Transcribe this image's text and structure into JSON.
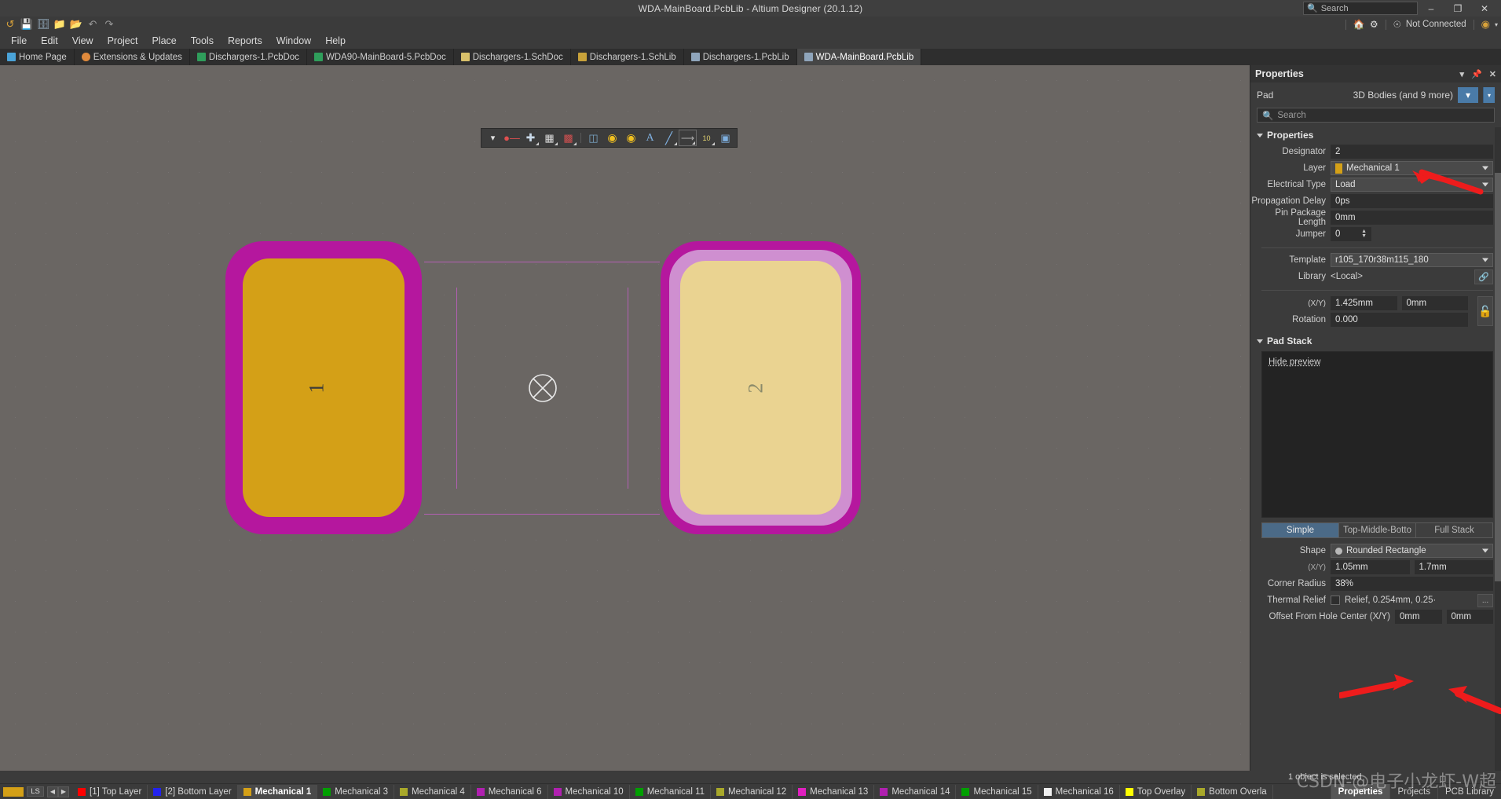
{
  "titlebar": {
    "title": "WDA-MainBoard.PcbLib - Altium Designer (20.1.12)",
    "search_placeholder": "Search",
    "minimize": "–",
    "maximize": "❐",
    "close": "✕"
  },
  "quickbar": {
    "icons": [
      "history-icon",
      "save-icon",
      "save-all-icon",
      "open-icon",
      "open-project-icon",
      "undo-icon",
      "redo-icon"
    ],
    "right": {
      "home_label": "home-icon",
      "settings_label": "gear-icon",
      "connection_status": "Not Connected",
      "account_icon": "account-icon",
      "chevron": "▾"
    }
  },
  "menu": {
    "items": [
      {
        "label": "File",
        "accel": "F"
      },
      {
        "label": "Edit",
        "accel": "E"
      },
      {
        "label": "View",
        "accel": "V"
      },
      {
        "label": "Project",
        "accel": "c"
      },
      {
        "label": "Place",
        "accel": "P"
      },
      {
        "label": "Tools",
        "accel": "T"
      },
      {
        "label": "Reports",
        "accel": "R"
      },
      {
        "label": "Window",
        "accel": "W"
      },
      {
        "label": "Help",
        "accel": "H"
      }
    ]
  },
  "doctabs": [
    {
      "label": "Home Page",
      "icon": "home-icon",
      "color": "#4aa3d8",
      "active": false
    },
    {
      "label": "Extensions & Updates",
      "icon": "extensions-icon",
      "color": "#e08a3c",
      "active": false
    },
    {
      "label": "Dischargers-1.PcbDoc",
      "icon": "pcbdoc-icon",
      "color": "#2f9e5b",
      "active": false
    },
    {
      "label": "WDA90-MainBoard-5.PcbDoc",
      "icon": "pcbdoc-icon",
      "color": "#2f9e5b",
      "active": false
    },
    {
      "label": "Dischargers-1.SchDoc",
      "icon": "schdoc-icon",
      "color": "#d8c06a",
      "active": false
    },
    {
      "label": "Dischargers-1.SchLib",
      "icon": "schlib-icon",
      "color": "#c8a23a",
      "active": false
    },
    {
      "label": "Dischargers-1.PcbLib",
      "icon": "pcblib-icon",
      "color": "#8fa5bb",
      "active": false
    },
    {
      "label": "WDA-MainBoard.PcbLib",
      "icon": "pcblib-icon",
      "color": "#8fa5bb",
      "active": true
    }
  ],
  "canvas_toolbar": {
    "buttons": [
      {
        "name": "filter-icon",
        "glyph": "▼",
        "color": "#dcdcdc"
      },
      {
        "name": "magnet-snap-icon",
        "glyph": "U",
        "color": "#e05050"
      },
      {
        "name": "crosshair-place-icon",
        "glyph": "✚",
        "color": "#b8c8d8"
      },
      {
        "name": "select-region-icon",
        "glyph": "⬚",
        "color": "#cfcfcf"
      },
      {
        "name": "align-icon",
        "glyph": "█",
        "color": "#d05050"
      },
      {
        "name": "layers-icon",
        "glyph": "▰",
        "color": "#7aa7c7"
      },
      {
        "name": "via-icon",
        "glyph": "◉",
        "color": "#f0c020"
      },
      {
        "name": "pad-icon",
        "glyph": "◉",
        "color": "#f0c020"
      },
      {
        "name": "text-icon",
        "glyph": "A",
        "color": "#7fb0e0"
      },
      {
        "name": "line-icon",
        "glyph": "╱",
        "color": "#7fb0e0"
      },
      {
        "name": "dimension-icon",
        "glyph": "↗",
        "color": "#b8b8b8"
      },
      {
        "name": "coordinate-icon",
        "glyph": "10",
        "color": "#e0d070"
      },
      {
        "name": "polygon-icon",
        "glyph": "▣",
        "color": "#7fb0e0"
      }
    ]
  },
  "canvas": {
    "pad1_designator": "1",
    "pad2_designator": "2",
    "origin_marker": "origin-crosshair",
    "pad_outer_color": "#b5179e",
    "pad1_fill": "#d4a017",
    "pad2_fill": "#ead391",
    "pad2_ring": "#cf8fd0",
    "courtyard_color": "#b35fb3",
    "background": "#6a6663"
  },
  "properties": {
    "panel_title": "Properties",
    "object_type": "Pad",
    "object_scope": "3D Bodies (and 9 more)",
    "search_placeholder": "Search",
    "sections": {
      "properties_label": "Properties",
      "pad_stack_label": "Pad Stack"
    },
    "fields": [
      {
        "label": "Designator",
        "value": "2",
        "type": "text"
      },
      {
        "label": "Layer",
        "value": "Mechanical 1",
        "type": "combo",
        "swatch": "#d4a017"
      },
      {
        "label": "Electrical Type",
        "value": "Load",
        "type": "combo"
      },
      {
        "label": "Propagation Delay",
        "value": "0ps",
        "type": "text"
      },
      {
        "label": "Pin Package Length",
        "value": "0mm",
        "type": "text"
      },
      {
        "label": "Jumper",
        "value": "0",
        "type": "spin"
      }
    ],
    "template": {
      "label": "Template",
      "value": "r105_170r38m115_180"
    },
    "library": {
      "label": "Library",
      "value": "<Local>",
      "link_icon": "link-icon"
    },
    "position": {
      "label": "(X/Y)",
      "x": "1.425mm",
      "y": "0mm"
    },
    "rotation": {
      "label": "Rotation",
      "value": "0.000"
    },
    "lock_icon": "unlock-icon",
    "hide_preview": "Hide preview",
    "stack_tabs": [
      {
        "label": "Simple",
        "active": true
      },
      {
        "label": "Top-Middle-Botto",
        "active": false
      },
      {
        "label": "Full Stack",
        "active": false
      }
    ],
    "shape": {
      "label": "Shape",
      "value": "Rounded Rectangle"
    },
    "size": {
      "label": "(X/Y)",
      "x": "1.05mm",
      "y": "1.7mm"
    },
    "corner_radius": {
      "label": "Corner Radius",
      "value": "38%"
    },
    "thermal_relief": {
      "label": "Thermal Relief",
      "value": "Relief, 0.254mm, 0.25·",
      "checked": false,
      "more": "..."
    },
    "offset_hole": {
      "label": "Offset From Hole Center (X/Y)",
      "x": "0mm",
      "y": "0mm"
    }
  },
  "status": {
    "text": "1 object is selected"
  },
  "layerbar": {
    "ls_label": "LS",
    "prev_arrow": "◀",
    "next_arrow": "▶",
    "active_swatch": "#d4a017",
    "layers": [
      {
        "label": "[1] Top Layer",
        "color": "#ff0000",
        "active": false
      },
      {
        "label": "[2] Bottom Layer",
        "color": "#2222ee",
        "active": false
      },
      {
        "label": "Mechanical 1",
        "color": "#d4a017",
        "active": true
      },
      {
        "label": "Mechanical 3",
        "color": "#00a000",
        "active": false
      },
      {
        "label": "Mechanical 4",
        "color": "#a8a82a",
        "active": false
      },
      {
        "label": "Mechanical 6",
        "color": "#b020b0",
        "active": false
      },
      {
        "label": "Mechanical 10",
        "color": "#b020b0",
        "active": false
      },
      {
        "label": "Mechanical 11",
        "color": "#00a000",
        "active": false
      },
      {
        "label": "Mechanical 12",
        "color": "#a8a82a",
        "active": false
      },
      {
        "label": "Mechanical 13",
        "color": "#e020c0",
        "active": false
      },
      {
        "label": "Mechanical 14",
        "color": "#b020b0",
        "active": false
      },
      {
        "label": "Mechanical 15",
        "color": "#00a000",
        "active": false
      },
      {
        "label": "Mechanical 16",
        "color": "#f0f0f0",
        "active": false
      },
      {
        "label": "Top Overlay",
        "color": "#ffff00",
        "active": false
      },
      {
        "label": "Bottom Overla",
        "color": "#a8a82a",
        "active": false
      }
    ],
    "panel_tabs": [
      {
        "label": "Properties",
        "active": true
      },
      {
        "label": "Projects",
        "active": false
      },
      {
        "label": "PCB Library",
        "active": false
      }
    ]
  },
  "watermark": "CSDN-@电子小龙虾-W超"
}
